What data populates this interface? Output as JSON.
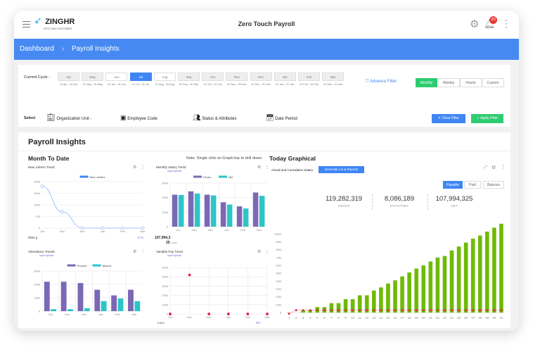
{
  "header": {
    "logo": "ZINGHR",
    "logo_tagline": "LET'S TALK OUTCOMES",
    "title": "Zero Touch Payroll",
    "notification_count": "20"
  },
  "breadcrumb": {
    "items": [
      "Dashboard",
      "Payroll Insights"
    ]
  },
  "filters": {
    "cycle_label": "Current Cycle -",
    "months": [
      {
        "m": "Apr",
        "r": "01 Apr - 30 Apr"
      },
      {
        "m": "May",
        "r": "01 May - 31 May"
      },
      {
        "m": "Jun",
        "r": "01 Jun - 30 Jun"
      },
      {
        "m": "Jul",
        "r": "01 Jul - 31 Jul"
      },
      {
        "m": "Aug",
        "r": "01 Aug - 31 Aug"
      },
      {
        "m": "Sep",
        "r": "01 Sep - 30 Sep"
      },
      {
        "m": "Oct",
        "r": "01 Oct - 31 Oct"
      },
      {
        "m": "Nov",
        "r": "01 Nov - 30 Nov"
      },
      {
        "m": "Dec",
        "r": "01 Dec - 31 Dec"
      },
      {
        "m": "Jan",
        "r": "01 Jan - 31 Jan"
      },
      {
        "m": "Feb",
        "r": "01 Feb - 28 Feb"
      },
      {
        "m": "Mar",
        "r": "01 Mar - 31 Mar"
      }
    ],
    "selected_month": "Jul",
    "advance_filter": "Advance Filter",
    "periods": [
      "Monthly",
      "Weekly",
      "Hourly",
      "Custom"
    ],
    "selected_period": "Monthly",
    "select_label": "Select",
    "org_unit": "Organization Unit -",
    "employee_code": "Employee Code",
    "status": "Status & Attributes",
    "date_period": "Date Period",
    "clear": "Clear Filter",
    "apply": "Apply Filter"
  },
  "insights": {
    "title": "Payroll Insights",
    "mtd": "Month To Date",
    "note": "Note: Single click on Graph bar to drill down.",
    "today": "Today Graphical"
  },
  "new_joiners": {
    "title": "New Joiners Trend",
    "legend": "New Joiners",
    "footer_left": "0Dm p",
    "footer_right": "0 %"
  },
  "salary": {
    "title": "Monthly Salary Trend",
    "sub": "Input Upload",
    "footer_value": "107,994,3",
    "footer_unit_value": "25",
    "footer_unit": "Lacs"
  },
  "attendance": {
    "title": "Attendance Trends",
    "sub": "Input Upload"
  },
  "variable": {
    "title": "Variable Pay Trend",
    "sub": "Input Upload",
    "footer_left": "Lacs",
    "footer_right": "0%"
  },
  "today": {
    "label": "Actual and Cumulative Salary",
    "generate": "Generate Lot & Reports",
    "tabs": [
      "Payable",
      "Paid",
      "Balance"
    ],
    "selected_tab": "Payable",
    "stats": [
      {
        "v": "119,282,319",
        "l": "GROSS"
      },
      {
        "v": "8,086,189",
        "l": "STATUTORY"
      },
      {
        "v": "107,994,325",
        "l": "NET"
      }
    ]
  },
  "colors": {
    "primary": "#4689f2",
    "green": "#2ecc71",
    "purple": "#7b68b5",
    "teal": "#2ec4c9",
    "bar_green": "#6fba07",
    "red": "#e0284b"
  },
  "chart_data": [
    {
      "type": "line",
      "title": "New Joiners Trend",
      "categories": [
        "Oct",
        "Nov",
        "Dec",
        "Jan",
        "Feb",
        "Mar"
      ],
      "series": [
        {
          "name": "New Joiners",
          "values": [
            360,
            140,
            0,
            0,
            0,
            0
          ]
        }
      ],
      "ytick_labels": [
        "0",
        "100",
        "200k",
        "300k",
        "300k"
      ],
      "ylim": [
        0,
        400
      ]
    },
    {
      "type": "bar",
      "title": "Monthly Salary Trend",
      "categories": [
        "Oct",
        "Nov",
        "Dec",
        "Jan",
        "Feb",
        "Mar"
      ],
      "series": [
        {
          "name": "Gross",
          "values": [
            220,
            243,
            220,
            168,
            140,
            235
          ]
        },
        {
          "name": "Net",
          "values": [
            218,
            228,
            215,
            152,
            125,
            212
          ]
        }
      ],
      "ytick_labels": [
        "0",
        "100k",
        "200k",
        "300k"
      ],
      "ylim": [
        0,
        300
      ]
    },
    {
      "type": "bar",
      "title": "Attendance Trends",
      "categories": [
        "Oct",
        "Nov",
        "Dec",
        "Jan",
        "Feb",
        "Mar"
      ],
      "series": [
        {
          "name": "Present",
          "values": [
            220,
            220,
            210,
            160,
            118,
            160
          ]
        },
        {
          "name": "Absent",
          "values": [
            15,
            15,
            22,
            75,
            95,
            75
          ]
        }
      ],
      "ytick_labels": [
        "0",
        "100k",
        "200k",
        "300k"
      ],
      "ylim": [
        0,
        300
      ]
    },
    {
      "type": "scatter",
      "title": "Variable Pay Trend",
      "categories": [
        "Oct",
        "Nov",
        "Dec",
        "Jan",
        "Feb",
        "Mar"
      ],
      "series": [
        {
          "values": [
            0,
            420,
            0,
            0,
            0,
            0
          ]
        }
      ],
      "ytick_labels": [
        "0",
        "100k",
        "200k",
        "300k",
        "300k",
        "300k"
      ],
      "ylim": [
        0,
        500
      ]
    },
    {
      "type": "bar",
      "title": "Actual and Cumulative Salary",
      "categories": [
        "1",
        "2",
        "3",
        "4",
        "5",
        "6",
        "7",
        "8",
        "9",
        "10",
        "11",
        "12",
        "13",
        "14",
        "15",
        "16",
        "17",
        "18",
        "19",
        "20",
        "21",
        "22",
        "23",
        "24",
        "25",
        "26",
        "27",
        "28",
        "29",
        "30",
        "31"
      ],
      "series": [
        {
          "type": "bar",
          "values": [
            0,
            0,
            3,
            3,
            7,
            7,
            12,
            12,
            17,
            17,
            22,
            22,
            28,
            32,
            37,
            41,
            46,
            51,
            56,
            60,
            65,
            70,
            72,
            79,
            84,
            89,
            94,
            98,
            103,
            108,
            113
          ]
        },
        {
          "type": "line",
          "values": [
            0,
            3,
            3,
            3,
            3,
            3,
            3,
            3,
            3,
            3,
            3,
            3,
            3,
            3,
            3,
            3,
            3,
            3,
            3,
            3,
            3,
            3,
            3,
            3,
            3,
            3,
            3,
            3,
            3,
            3,
            3
          ]
        }
      ],
      "ytick_labels": [
        "0",
        "10M",
        "20M",
        "30M",
        "40M",
        "50M",
        "60M",
        "70M",
        "80M",
        "90M",
        "100M"
      ],
      "ylim": [
        0,
        120
      ],
      "unit": "M"
    }
  ]
}
